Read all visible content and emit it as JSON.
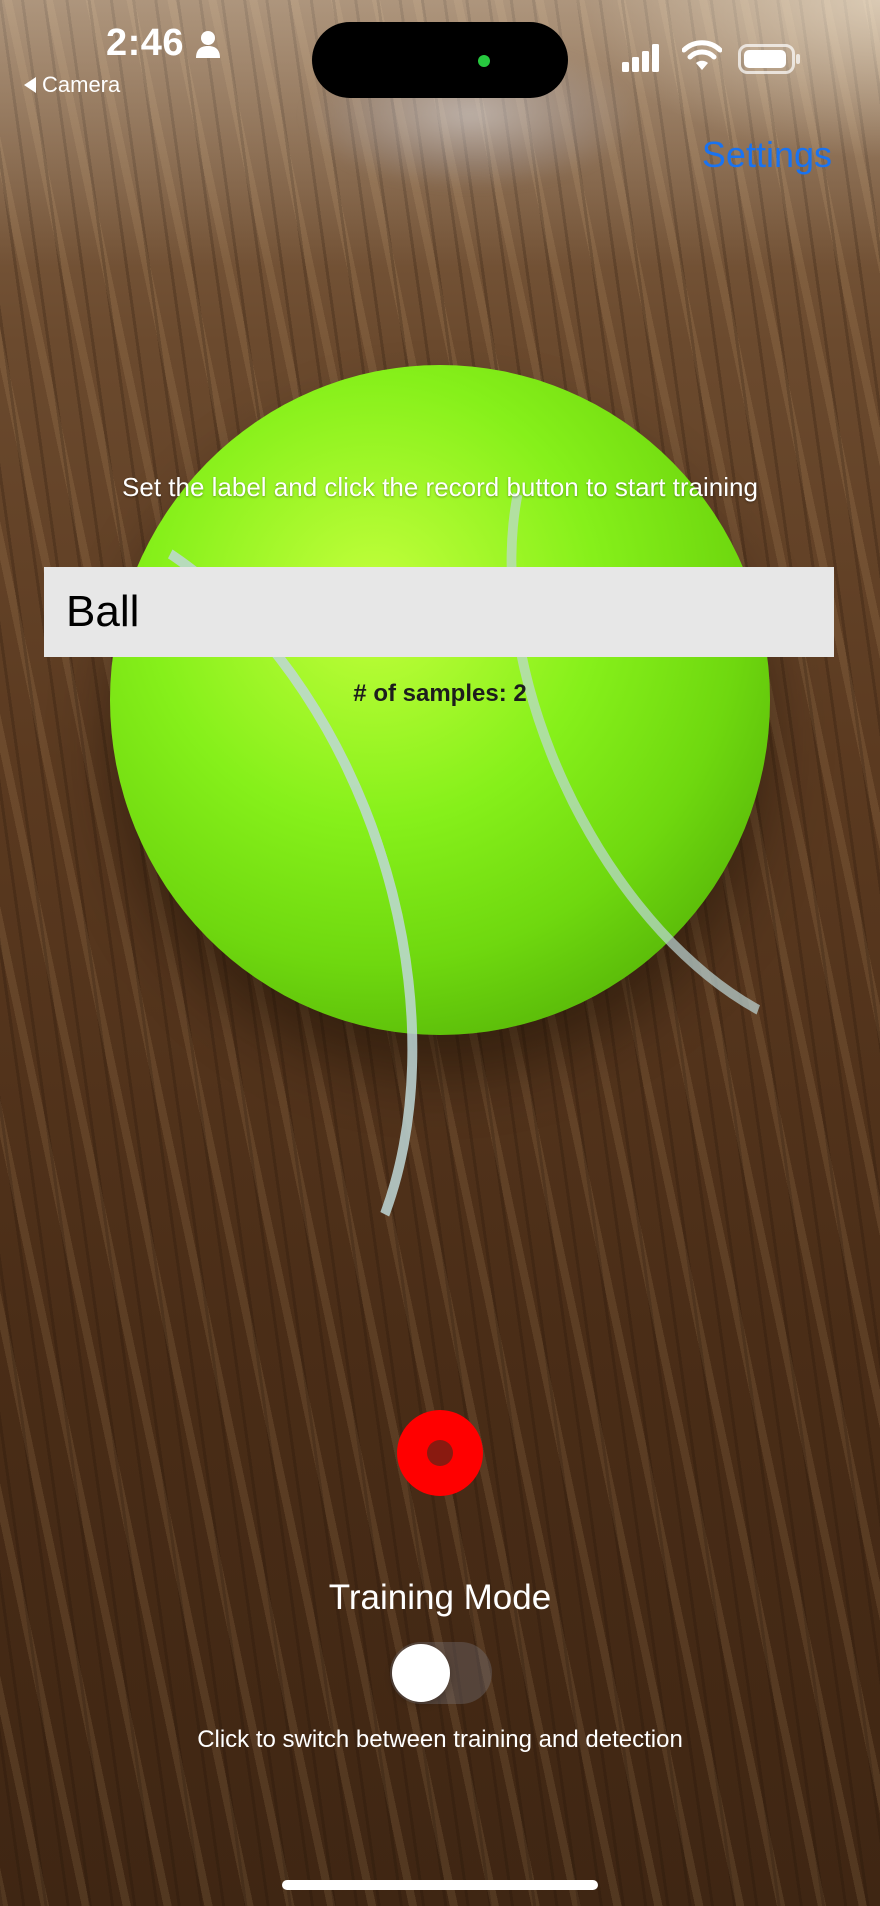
{
  "status_bar": {
    "time": "2:46",
    "back_label": "Camera"
  },
  "nav": {
    "settings_label": "Settings"
  },
  "training": {
    "instruction": "Set the label and click the record button to start training",
    "label_value": "Ball",
    "samples_text": "# of samples: 2"
  },
  "mode": {
    "title": "Training Mode",
    "toggle_on": false,
    "hint": "Click to switch between training and detection"
  },
  "colors": {
    "link": "#1a73f0",
    "record": "#ff0000",
    "input_bg": "#e7e7e7"
  },
  "icons": {
    "status": [
      "person-icon",
      "signal-icon",
      "wifi-icon",
      "battery-icon"
    ],
    "back": "back-arrow-icon",
    "record": "record-icon"
  }
}
